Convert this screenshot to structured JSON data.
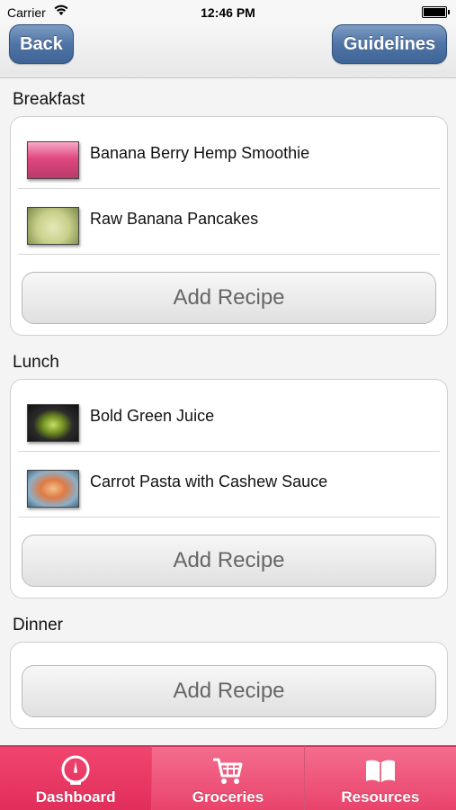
{
  "status_bar": {
    "carrier": "Carrier",
    "time": "12:46 PM"
  },
  "nav": {
    "back_label": "Back",
    "guidelines_label": "Guidelines"
  },
  "sections": [
    {
      "title": "Breakfast",
      "items": [
        {
          "label": "Banana Berry Hemp Smoothie",
          "thumb_color": "#e0487f"
        },
        {
          "label": "Raw Banana Pancakes",
          "thumb_color": "#c8d08a"
        }
      ],
      "add_label": "Add Recipe"
    },
    {
      "title": "Lunch",
      "items": [
        {
          "label": "Bold Green Juice",
          "thumb_color": "#6f8f1f"
        },
        {
          "label": "Carrot Pasta with Cashew Sauce",
          "thumb_color": "#e07a45"
        }
      ],
      "add_label": "Add Recipe"
    },
    {
      "title": "Dinner",
      "items": [],
      "add_label": "Add Recipe"
    }
  ],
  "tabs": [
    {
      "label": "Dashboard",
      "icon": "gauge-icon",
      "active": true
    },
    {
      "label": "Groceries",
      "icon": "cart-icon",
      "active": false
    },
    {
      "label": "Resources",
      "icon": "book-icon",
      "active": false
    }
  ],
  "colors": {
    "nav_button": "#4f74a6",
    "tab_bar": "#e9436b",
    "card_border": "#cfcfcf"
  }
}
